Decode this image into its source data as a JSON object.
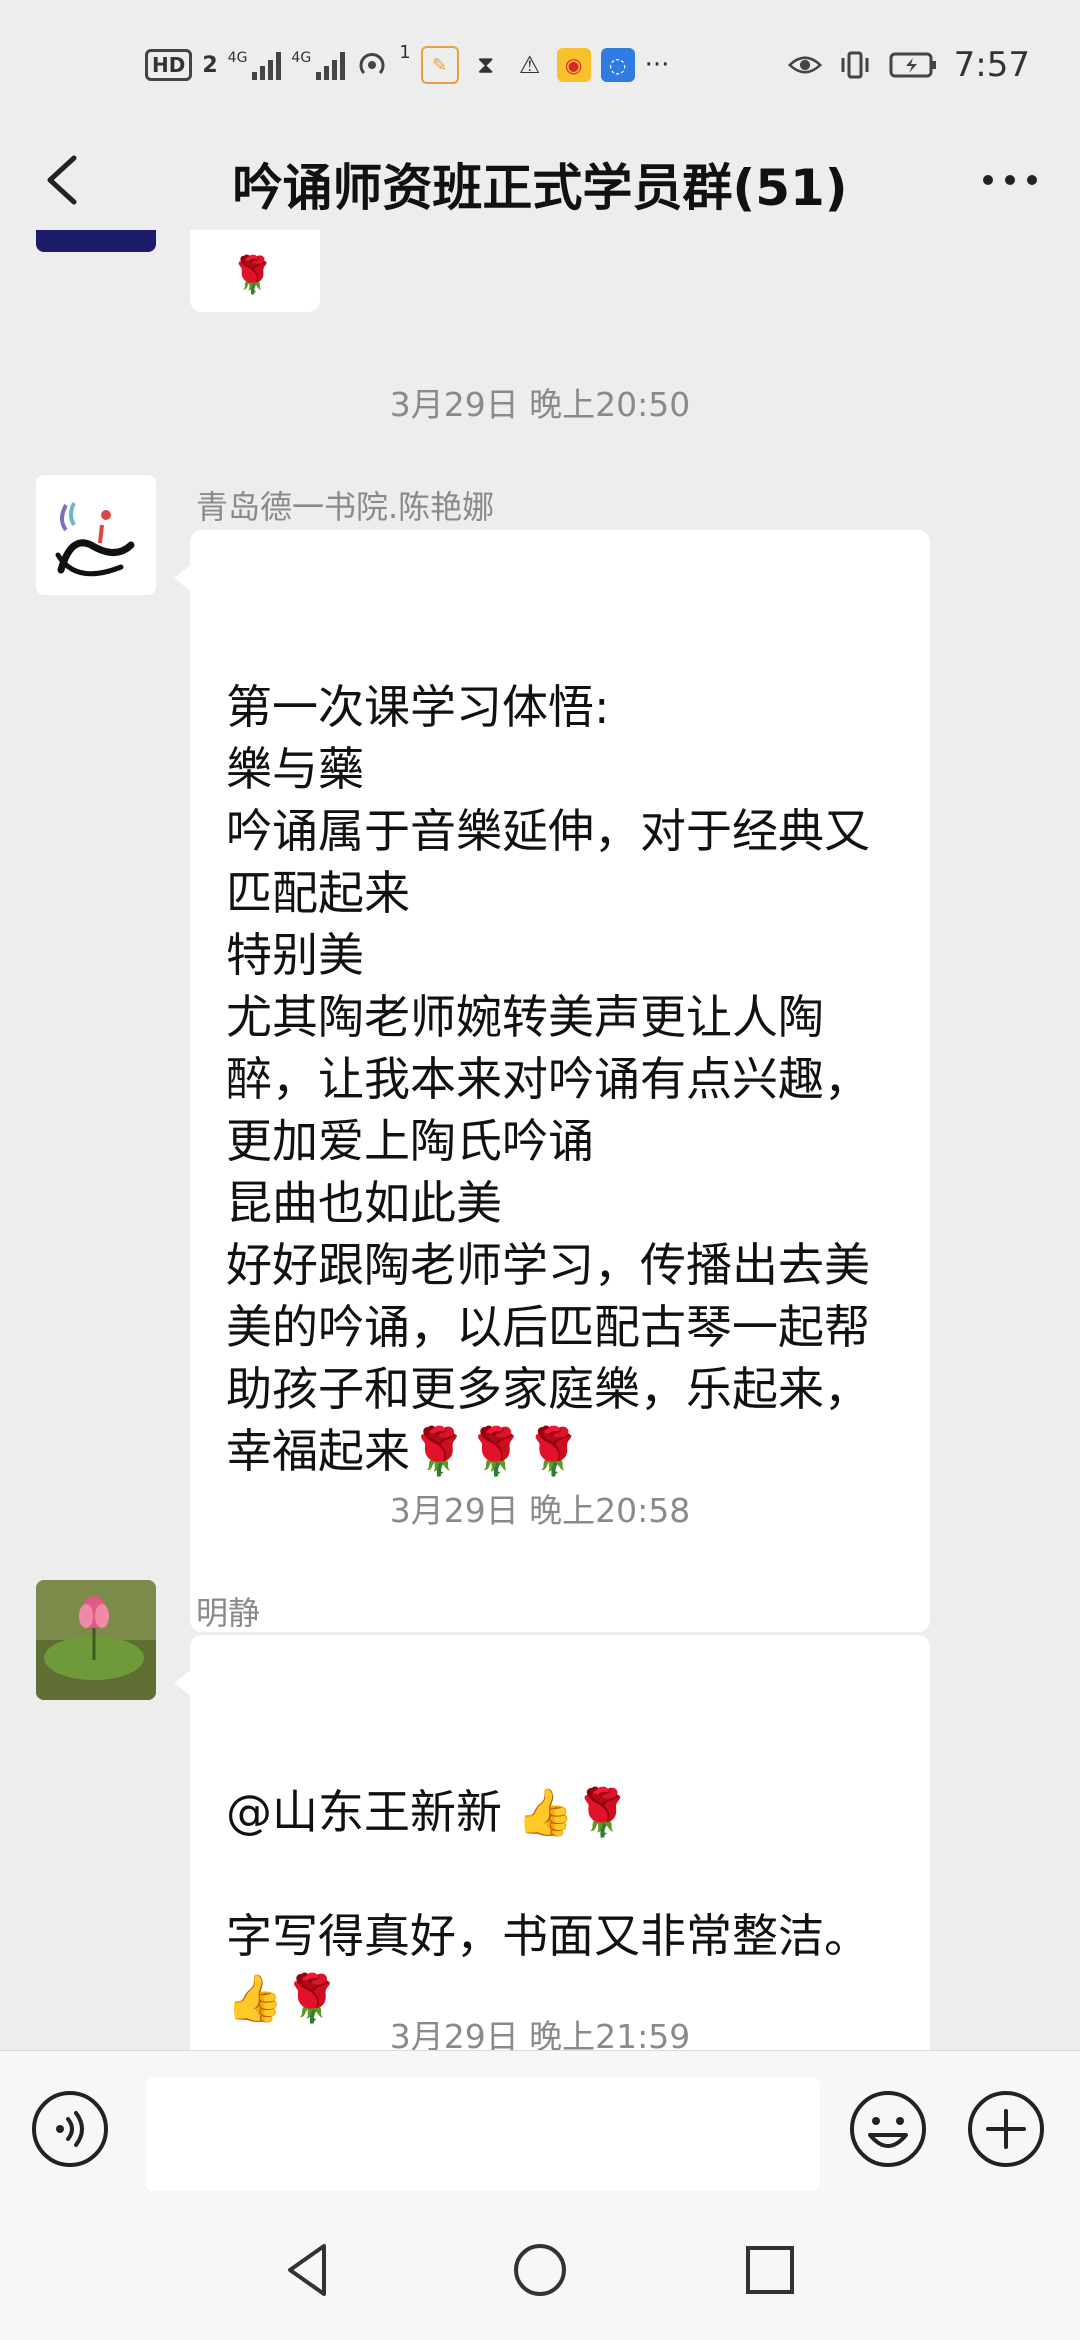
{
  "status_bar": {
    "hd": "HD",
    "sim": "2",
    "network1": "4G",
    "network2": "4G",
    "hotspot_count": "1",
    "more": "···",
    "time": "7:57"
  },
  "header": {
    "title": "吟诵师资班正式学员群(51)"
  },
  "messages": [
    {
      "timestamp": "3月29日 晚上20:50",
      "sender": "青岛德一书院.陈艳娜",
      "text": "第一次课学习体悟:\n樂与藥\n吟诵属于音樂延伸，对于经典又匹配起来\n特别美\n尤其陶老师婉转美声更让人陶醉，让我本来对吟诵有点兴趣，更加爱上陶氏吟诵\n昆曲也如此美\n好好跟陶老师学习，传播出去美美的吟诵，以后匹配古琴一起帮助孩子和更多家庭樂，乐起来，幸福起来🌹🌹🌹"
    },
    {
      "timestamp": "3月29日 晚上20:58",
      "sender": "明静",
      "text": "@山东王新新 👍🌹\n\n字写得真好，书面又非常整洁。👍🌹"
    },
    {
      "timestamp": "3月29日 晚上21:59"
    }
  ],
  "partial_message": {
    "text": "🌹"
  },
  "input": {
    "value": "",
    "placeholder": ""
  },
  "colors": {
    "background": "#ededed",
    "bubble": "#ffffff",
    "meta_text": "#8a8a8a"
  }
}
